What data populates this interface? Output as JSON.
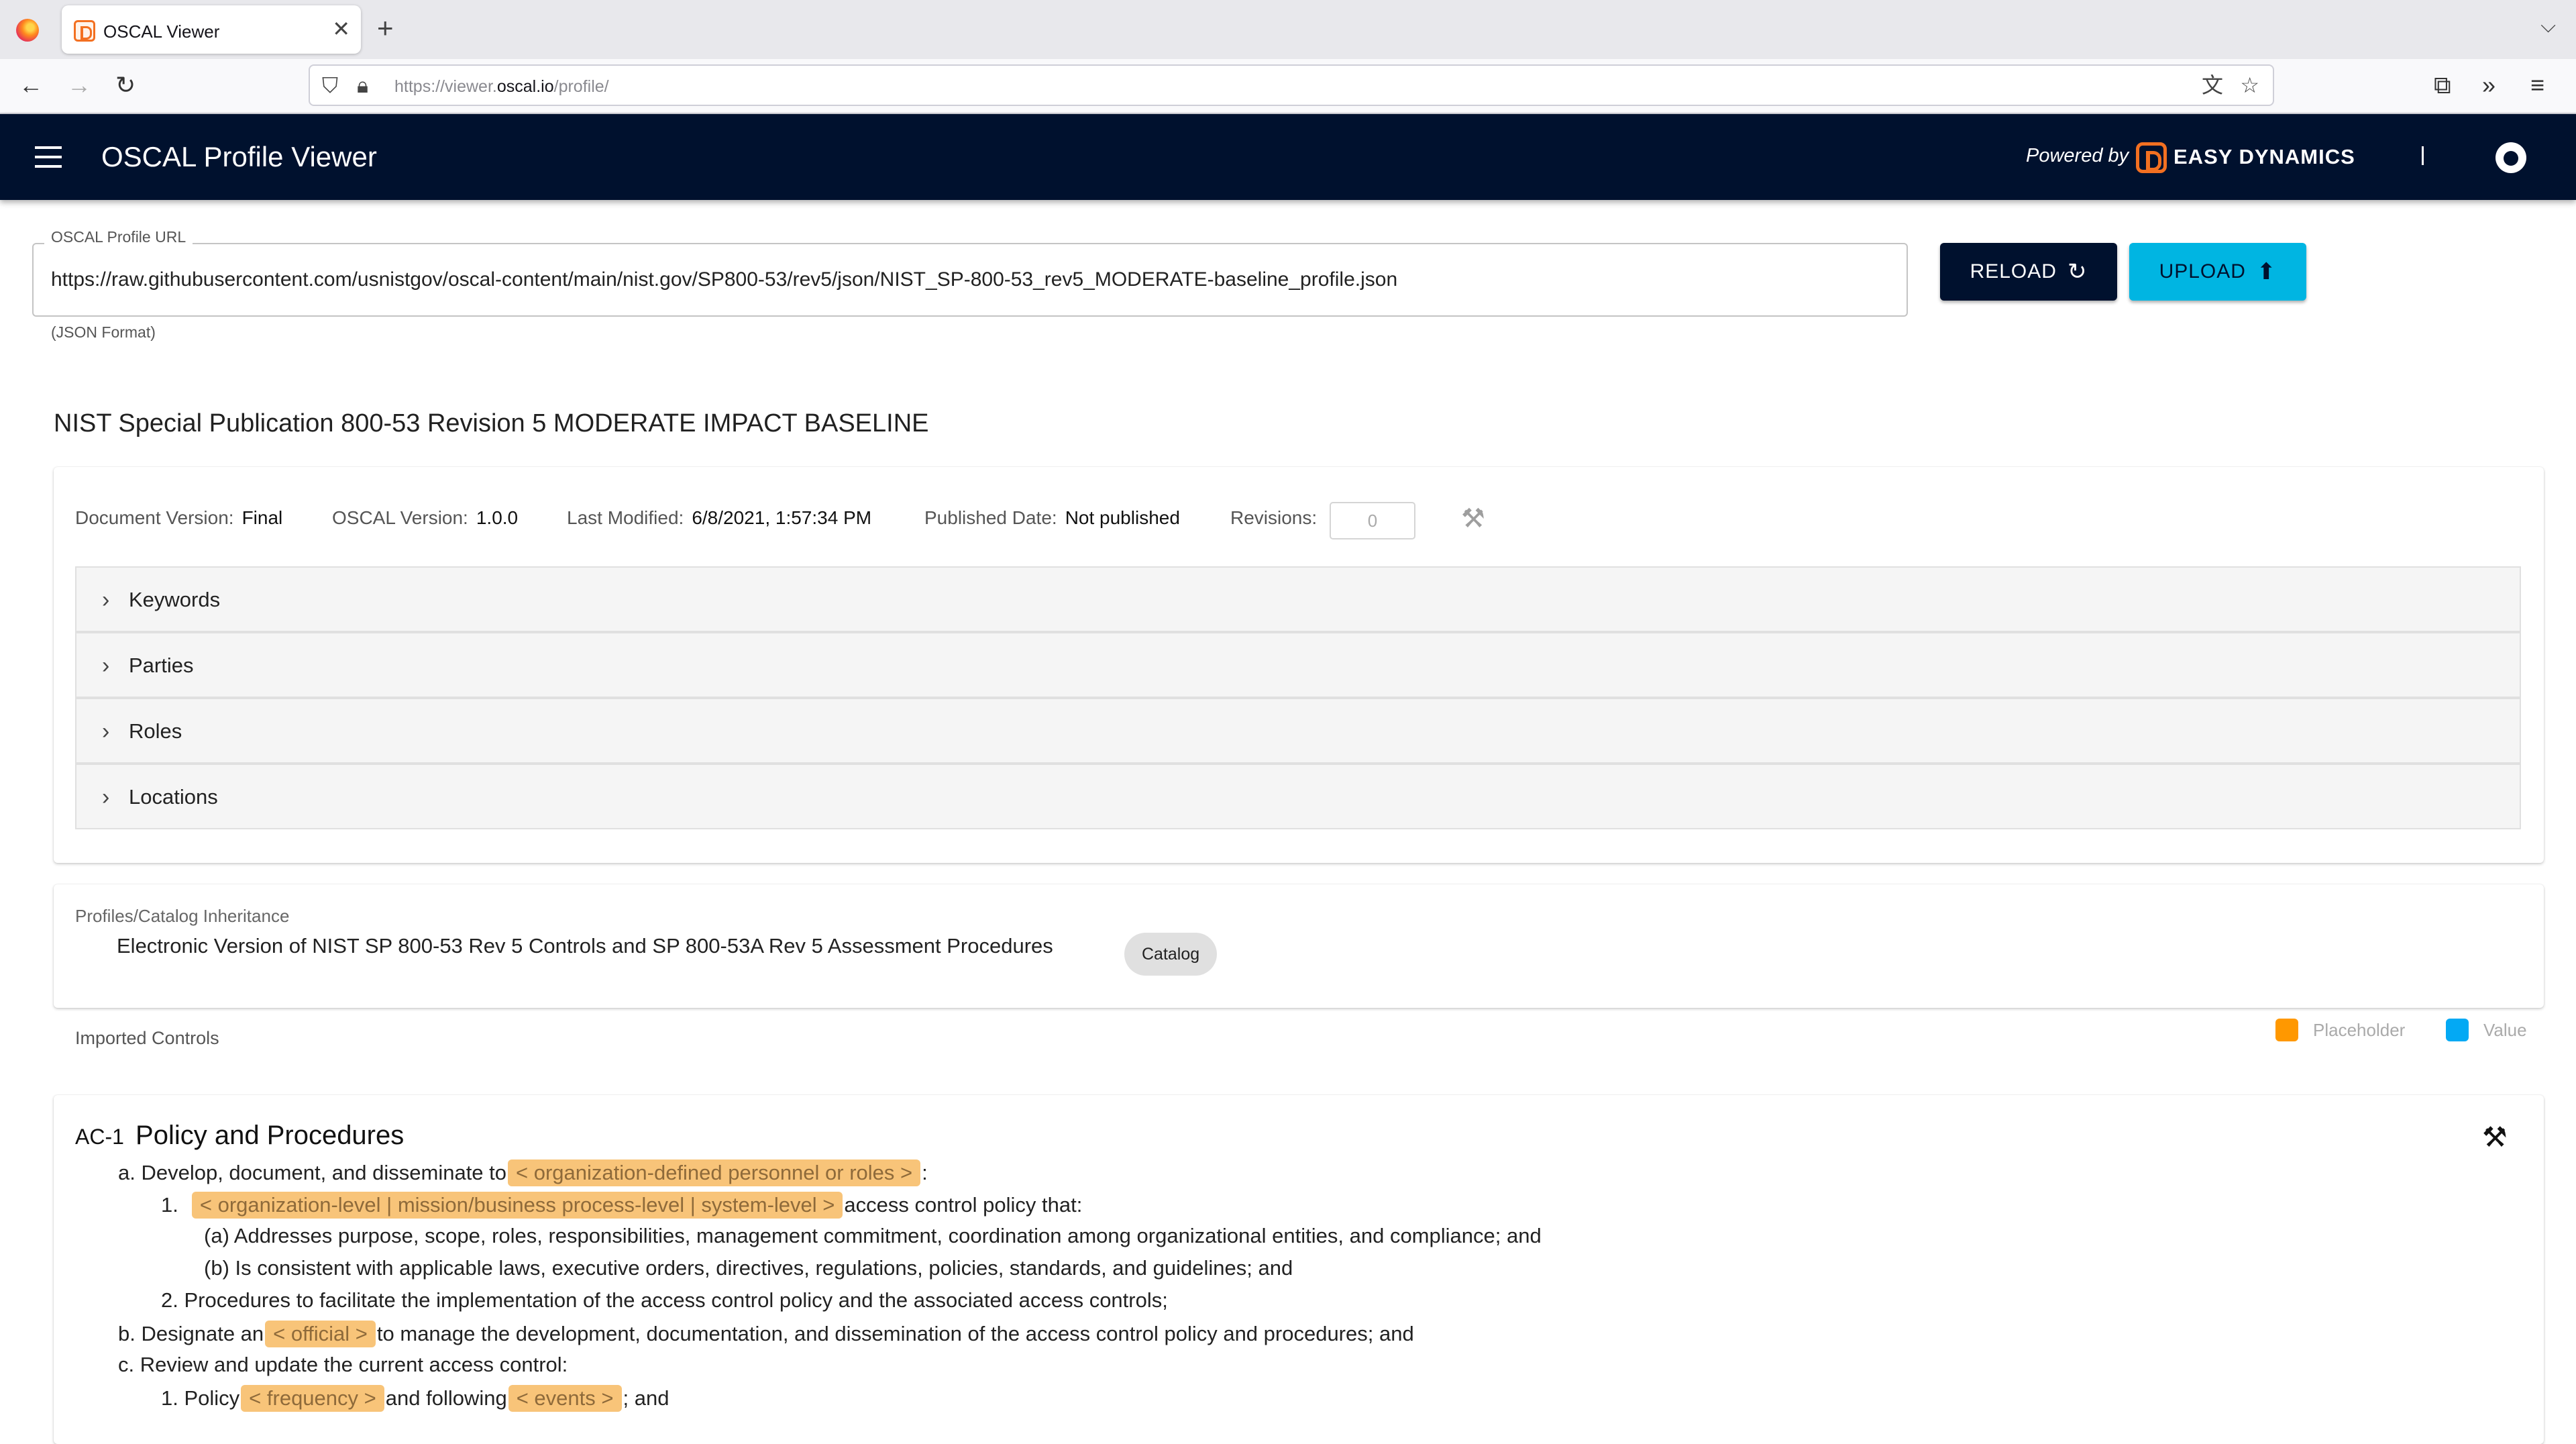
{
  "browser": {
    "tab_title": "OSCAL Viewer",
    "url_prefix": "https://viewer.",
    "url_host": "oscal.io",
    "url_path": "/profile/"
  },
  "header": {
    "title": "OSCAL Profile Viewer",
    "powered_by": "Powered by",
    "brand": "EASY DYNAMICS",
    "brand_color": "#f37021",
    "bg_color": "#00112e"
  },
  "url_field": {
    "label": "OSCAL Profile URL",
    "value": "https://raw.githubusercontent.com/usnistgov/oscal-content/main/nist.gov/SP800-53/rev5/json/NIST_SP-800-53_rev5_MODERATE-baseline_profile.json",
    "helper": "(JSON Format)"
  },
  "buttons": {
    "reload": "RELOAD",
    "upload": "UPLOAD",
    "upload_color": "#00b5e2"
  },
  "document": {
    "title": "NIST Special Publication 800-53 Revision 5 MODERATE IMPACT BASELINE"
  },
  "metadata": {
    "doc_version_label": "Document Version:",
    "doc_version": "Final",
    "oscal_version_label": "OSCAL Version:",
    "oscal_version": "1.0.0",
    "last_modified_label": "Last Modified:",
    "last_modified": "6/8/2021, 1:57:34 PM",
    "published_label": "Published Date:",
    "published": "Not published",
    "revisions_label": "Revisions:",
    "revisions": "0"
  },
  "accordions": [
    "Keywords",
    "Parties",
    "Roles",
    "Locations"
  ],
  "inheritance": {
    "label": "Profiles/Catalog Inheritance",
    "item": "Electronic Version of NIST SP 800-53 Rev 5 Controls and SP 800-53A Rev 5 Assessment Procedures",
    "chip": "Catalog"
  },
  "imported_controls": {
    "label": "Imported Controls",
    "legend_placeholder": "Placeholder",
    "legend_value": "Value",
    "placeholder_color": "#ff9800",
    "value_color": "#03a9f4"
  },
  "control": {
    "id": "AC-1",
    "title": "Policy and Procedures",
    "a_text": "a. Develop, document, and disseminate to",
    "a_param": "< organization-defined personnel or roles >",
    "a_tail": ":",
    "a1_num": "1.",
    "a1_param": "< organization-level | mission/business process-level | system-level >",
    "a1_tail": "access control policy that:",
    "a1a": "(a) Addresses purpose, scope, roles, responsibilities, management commitment, coordination among organizational entities, and compliance; and",
    "a1b": "(b) Is consistent with applicable laws, executive orders, directives, regulations, policies, standards, and guidelines; and",
    "a2": "2. Procedures to facilitate the implementation of the access control policy and the associated access controls;",
    "b_text": "b. Designate an",
    "b_param": "< official >",
    "b_tail": "to manage the development, documentation, and dissemination of the access control policy and procedures; and",
    "c_text": "c. Review and update the current access control:",
    "c1_text": "1. Policy",
    "c1_param1": "< frequency >",
    "c1_mid": "and following",
    "c1_param2": "< events >",
    "c1_tail": "; and"
  }
}
